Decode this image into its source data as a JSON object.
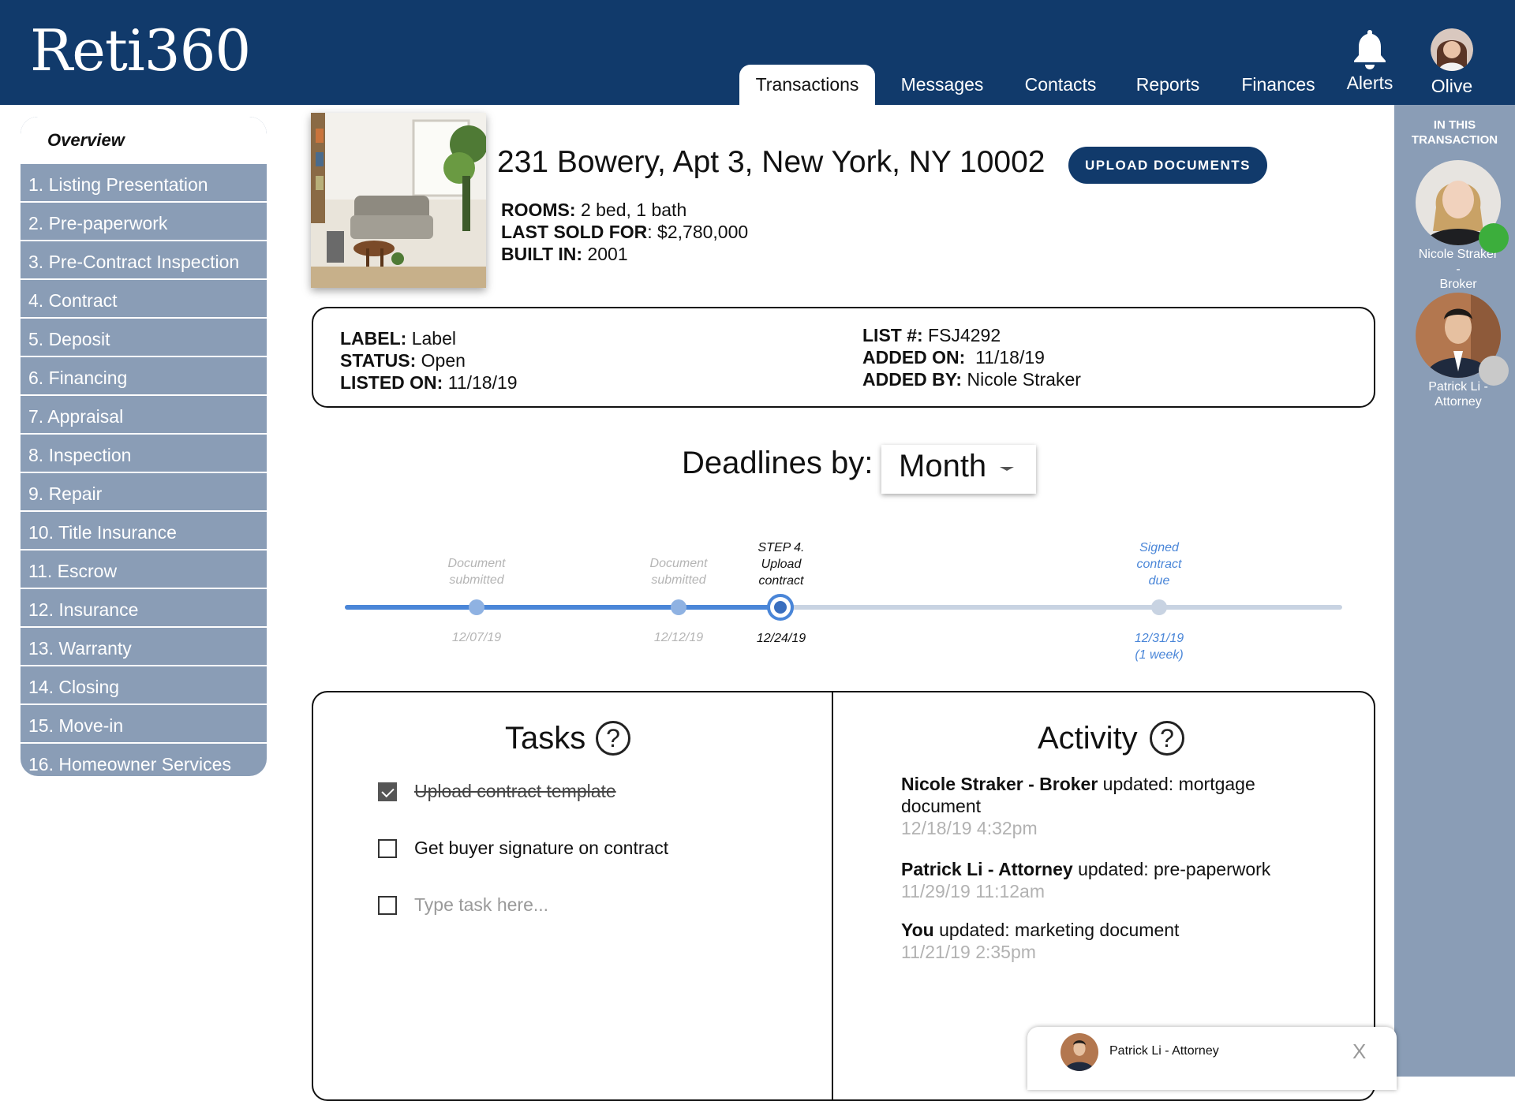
{
  "app": {
    "logo": "Reti360"
  },
  "nav": {
    "tabs": [
      {
        "label": "Transactions",
        "active": true
      },
      {
        "label": "Messages"
      },
      {
        "label": "Contacts"
      },
      {
        "label": "Reports"
      },
      {
        "label": "Finances"
      }
    ],
    "alerts_label": "Alerts",
    "profile_name": "Olive"
  },
  "sidebar": {
    "overview_label": "Overview",
    "items": [
      "1. Listing  Presentation",
      "2. Pre-paperwork",
      "3. Pre-Contract Inspection",
      "4. Contract",
      "5. Deposit",
      "6. Financing",
      "7. Appraisal",
      "8. Inspection",
      "9. Repair",
      "10. Title Insurance",
      "11. Escrow",
      "12. Insurance",
      "13. Warranty",
      "14. Closing",
      "15. Move-in",
      "16. Homeowner Services"
    ]
  },
  "property": {
    "address": "231 Bowery, Apt 3, New York, NY 10002",
    "upload_button": "UPLOAD DOCUMENTS",
    "rooms_label": "ROOMS:",
    "rooms_value": " 2 bed, 1 bath",
    "sold_label": "LAST SOLD FOR",
    "sold_value": ": $2,780,000",
    "built_label": "BUILT IN:",
    "built_value": " 2001"
  },
  "info": {
    "label_key": "LABEL:",
    "label_value": " Label",
    "status_key": "STATUS:",
    "status_value": " Open",
    "listed_key": "LISTED ON:",
    "listed_value": " 11/18/19",
    "list_key": "LIST #:",
    "list_value": " FSJ4292",
    "added_on_key": "ADDED ON:",
    "added_on_value": "  11/18/19",
    "added_by_key": "ADDED BY:",
    "added_by_value": " Nicole Straker"
  },
  "deadlines": {
    "label": "Deadlines by:",
    "selected": "Month",
    "progress_fraction": 0.434,
    "steps": [
      {
        "line1": "Document",
        "line2": "submitted",
        "line3": "",
        "date1": "12/07/19",
        "date2": "",
        "state": "done"
      },
      {
        "line1": "Document",
        "line2": "submitted",
        "line3": "",
        "date1": "12/12/19",
        "date2": "",
        "state": "done"
      },
      {
        "line1": "STEP 4.",
        "line2": "Upload",
        "line3": "contract",
        "date1": "12/24/19",
        "date2": "",
        "state": "current"
      },
      {
        "line1": "Signed",
        "line2": "contract",
        "line3": "due",
        "date1": "12/31/19",
        "date2": "(1 week)",
        "state": "upcoming"
      }
    ]
  },
  "tasks": {
    "title": "Tasks",
    "help": "?",
    "items": [
      {
        "text": "Upload contract template",
        "done": true
      },
      {
        "text": "Get buyer signature on contract",
        "done": false
      }
    ],
    "new_placeholder": "Type task here..."
  },
  "activity": {
    "title": "Activity",
    "help": "?",
    "entries": [
      {
        "actor": "Nicole Straker - Broker",
        "action": " updated: mortgage document",
        "time": "12/18/19 4:32pm"
      },
      {
        "actor": "Patrick Li - Attorney",
        "action": " updated: pre-paperwork",
        "time": "11/29/19 11:12am"
      },
      {
        "actor": "You",
        "action": " updated: marketing document",
        "time": "11/21/19 2:35pm"
      }
    ]
  },
  "rail": {
    "title_line1": "IN THIS",
    "title_line2": "TRANSACTION",
    "people": [
      {
        "name_line1": "Nicole Straker -",
        "name_line2": "Broker",
        "status": "online",
        "status_color": "#3cae3c"
      },
      {
        "name_line1": "Patrick Li -",
        "name_line2": "Attorney",
        "status": "offline",
        "status_color": "#c9c9c9"
      }
    ]
  },
  "chat": {
    "name": "Patrick Li - Attorney",
    "close": "X"
  },
  "colors": {
    "brand": "#113a6b",
    "sidebar": "#8a9db6",
    "timeline_active": "#4a86d8",
    "timeline_inactive": "#c8d3e2",
    "link_blue": "#4a86d8"
  }
}
